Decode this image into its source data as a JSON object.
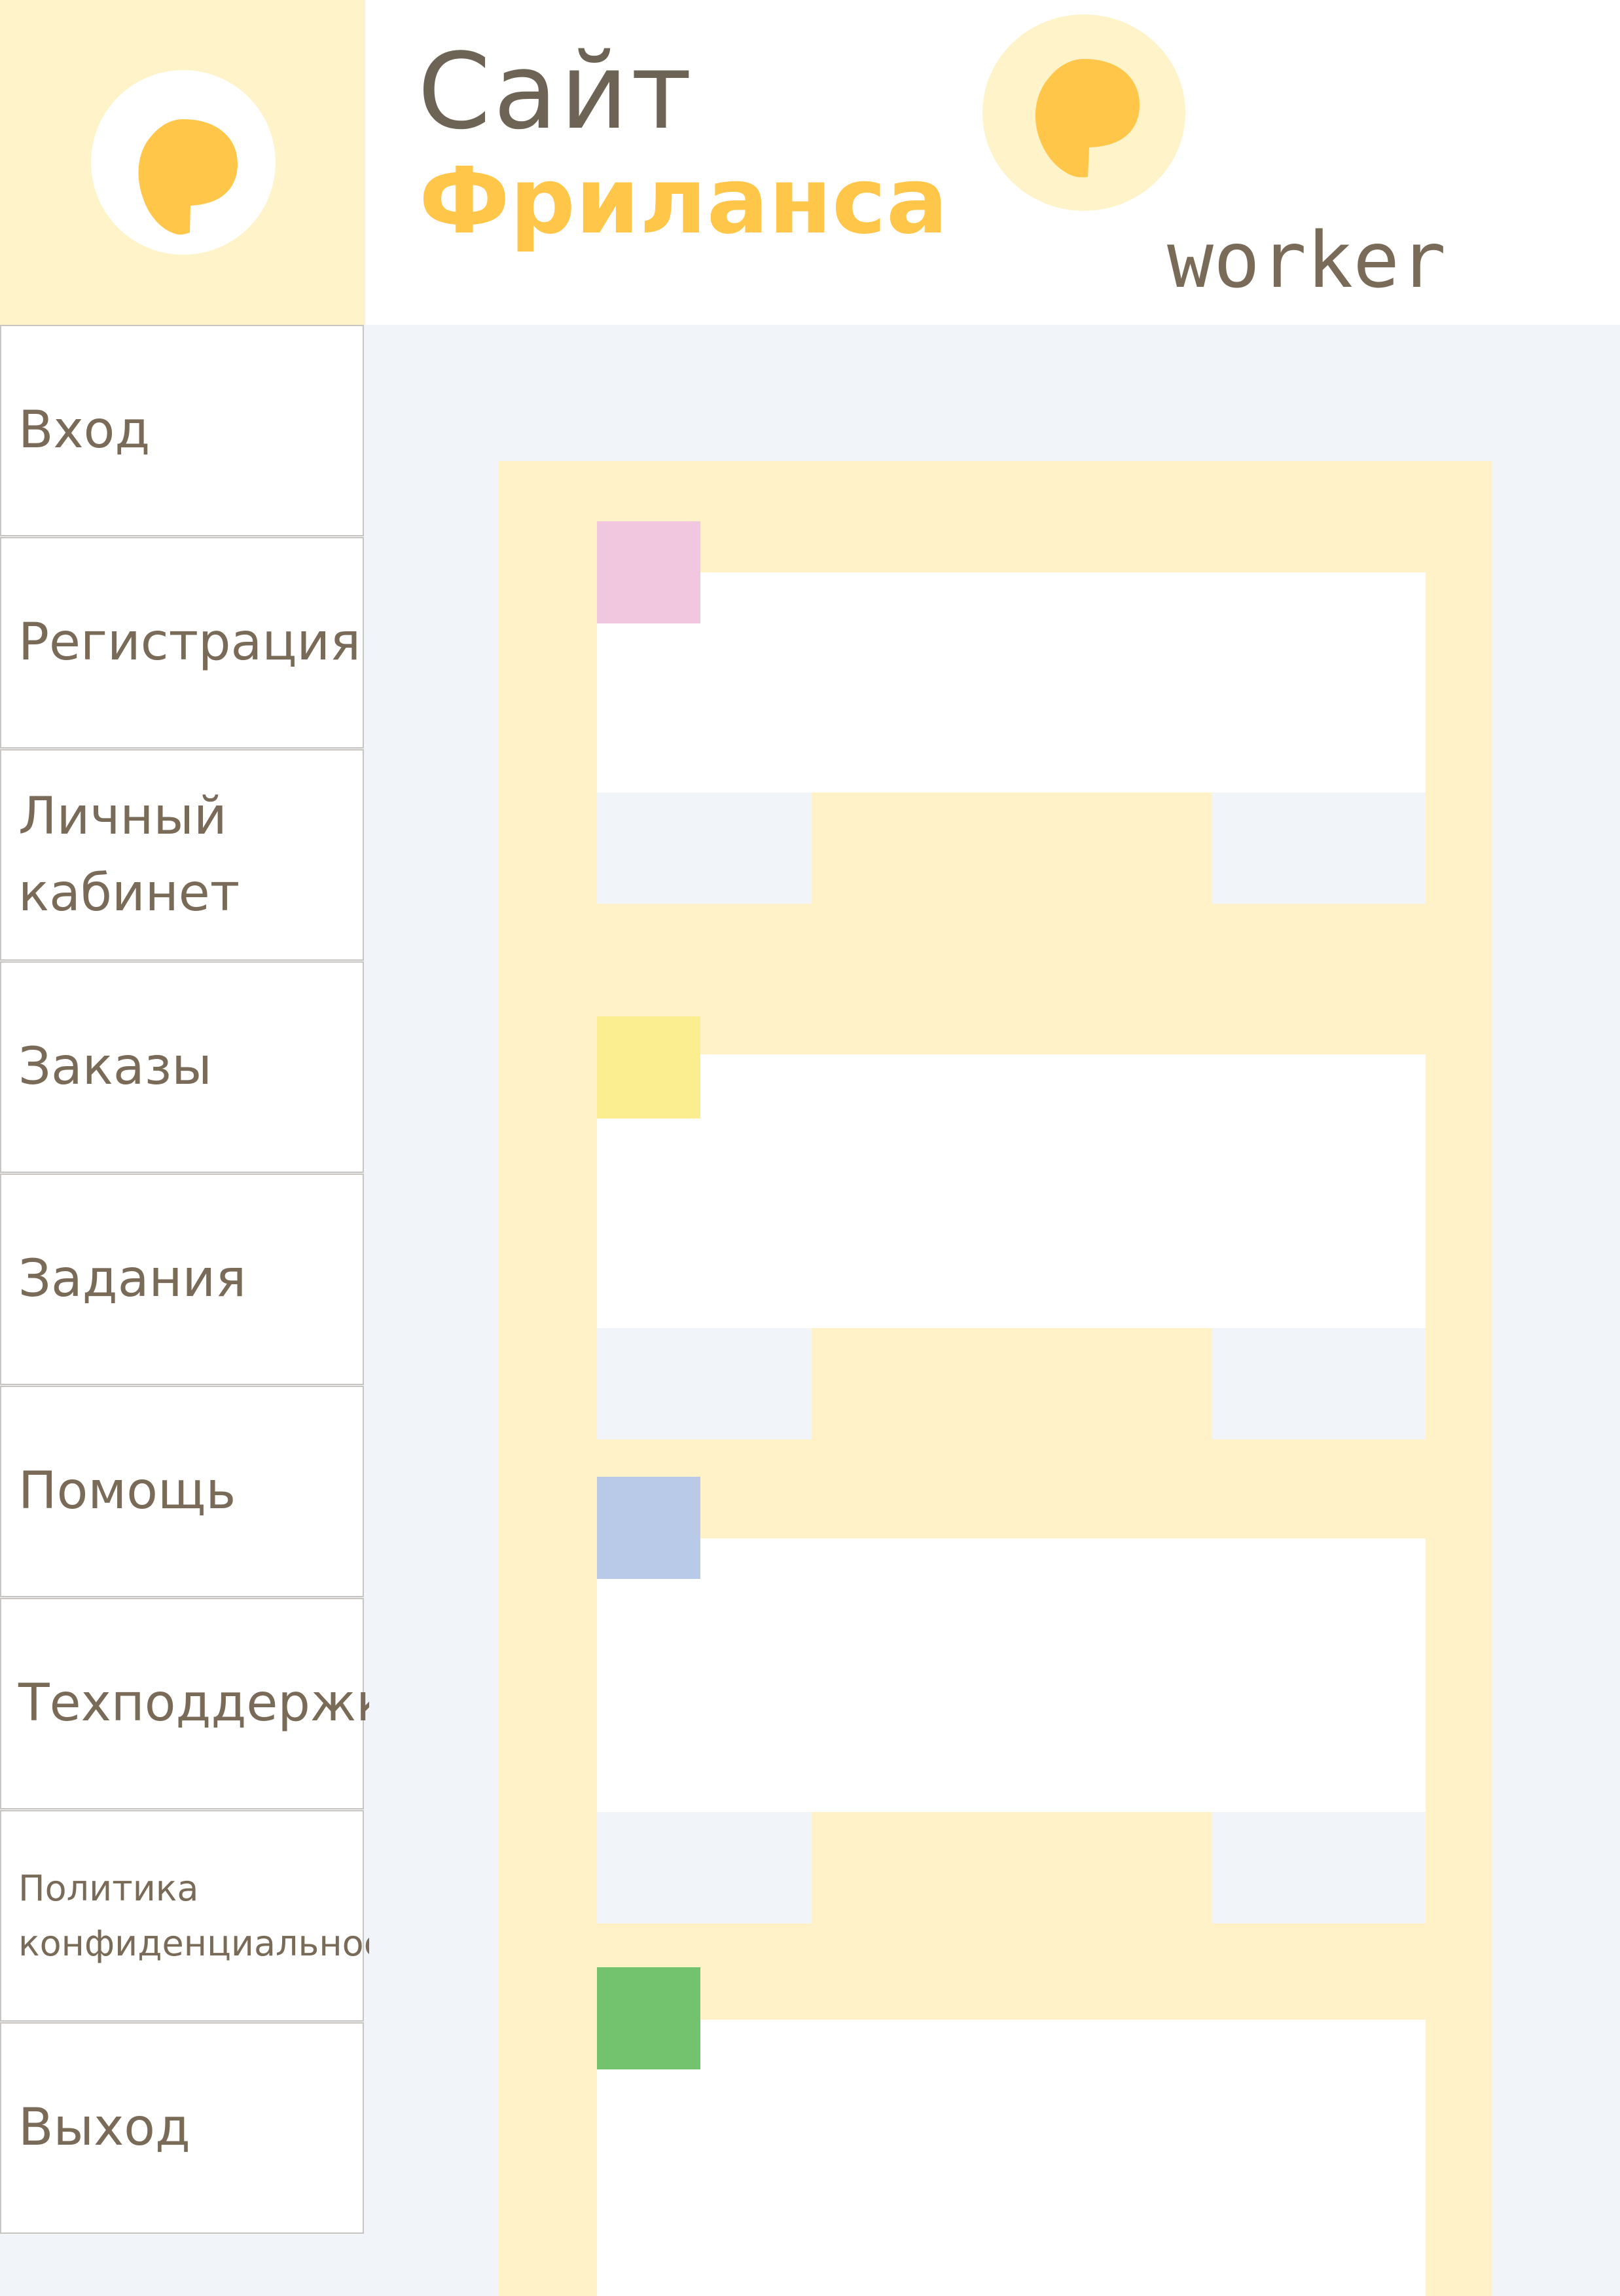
{
  "header": {
    "title_line1": "Сайт",
    "title_line2": "Фриланса",
    "role": "worker",
    "logo_icon": "speech-bubble-logo",
    "colors": {
      "brand": "#ffc64a",
      "brand_bg": "#fef3c9",
      "text": "#7a6b58"
    }
  },
  "sidebar": {
    "items": [
      {
        "label": "Вход",
        "size": "large"
      },
      {
        "label": "Регистрация",
        "size": "large"
      },
      {
        "label": "Личный кабинет",
        "size": "large"
      },
      {
        "label": "Заказы",
        "size": "large"
      },
      {
        "label": "Задания",
        "size": "large"
      },
      {
        "label": "Помощь",
        "size": "large"
      },
      {
        "label": "Техподдержка",
        "size": "large"
      },
      {
        "label": "Политика конфиденциальности",
        "size": "small"
      },
      {
        "label": "Выход",
        "size": "large"
      }
    ]
  },
  "main": {
    "cards": [
      {
        "tag_color": "#f1c7df"
      },
      {
        "tag_color": "#fbee91"
      },
      {
        "tag_color": "#b9c9e8"
      },
      {
        "tag_color": "#73c26d"
      }
    ]
  }
}
